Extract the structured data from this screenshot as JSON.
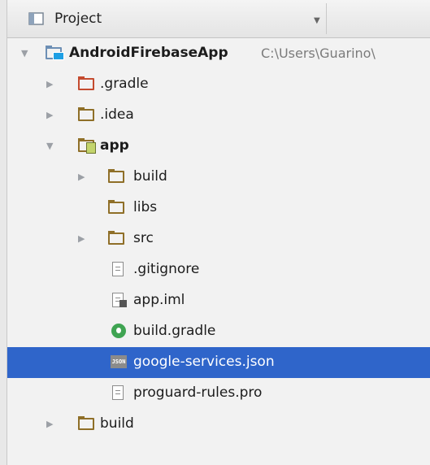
{
  "panel": {
    "title": "Project"
  },
  "tree": {
    "root": {
      "label": "AndroidFirebaseApp",
      "path": "C:\\Users\\Guarino\\"
    },
    "items": [
      {
        "label": ".gradle"
      },
      {
        "label": ".idea"
      },
      {
        "label": "app"
      },
      {
        "label": "build"
      },
      {
        "label": "libs"
      },
      {
        "label": "src"
      },
      {
        "label": ".gitignore"
      },
      {
        "label": "app.iml"
      },
      {
        "label": "build.gradle"
      },
      {
        "label": "google-services.json"
      },
      {
        "label": "proguard-rules.pro"
      },
      {
        "label": "build"
      }
    ],
    "selected": "google-services.json"
  },
  "colors": {
    "selection": "#2f65ca",
    "folder": "#8f6f28",
    "excluded_folder": "#c44b2f",
    "module_folder": "#c3d46c",
    "gradle": "#3fa452"
  },
  "icons": {
    "panel": "project-icon",
    "folder": "folder-icon",
    "text_file": "text-file-icon",
    "iml": "iml-file-icon",
    "gradle": "gradle-icon",
    "json": "json-icon"
  }
}
